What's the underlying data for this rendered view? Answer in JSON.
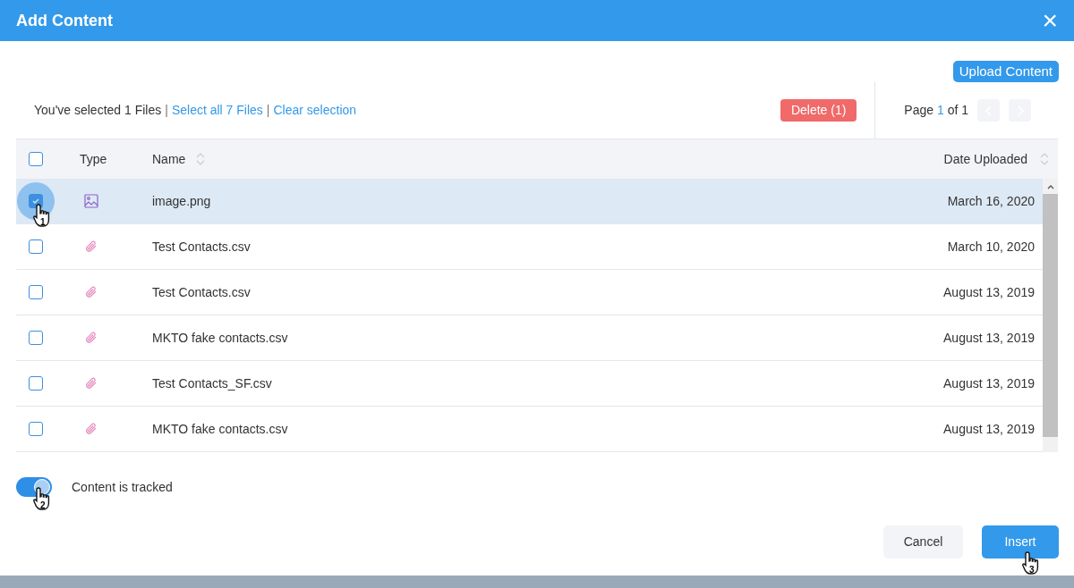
{
  "dialog": {
    "title": "Add Content",
    "close": "×"
  },
  "upload_button": "Upload Content",
  "selection": {
    "summary": "You've selected 1 Files",
    "separator_1": "|",
    "select_all": "Select all 7 Files",
    "separator_2": "|",
    "clear": "Clear selection"
  },
  "delete_button": "Delete (1)",
  "pager": {
    "label": "Page",
    "current": "1",
    "of": "of 1",
    "prev_disabled": true,
    "next_disabled": true
  },
  "table": {
    "columns": [
      "Type",
      "Name",
      "Date Uploaded"
    ],
    "select_all_checked": false,
    "rows": [
      {
        "kind": "image",
        "name": "image.png",
        "date": "March 16, 2020",
        "checked": true,
        "selected": true,
        "callout": "1"
      },
      {
        "kind": "attachment",
        "name": "Test Contacts.csv",
        "date": "March 10, 2020",
        "checked": false,
        "selected": false
      },
      {
        "kind": "attachment",
        "name": "Test Contacts.csv",
        "date": "August 13, 2019",
        "checked": false,
        "selected": false
      },
      {
        "kind": "attachment",
        "name": "MKTO fake contacts.csv",
        "date": "August 13, 2019",
        "checked": false,
        "selected": false
      },
      {
        "kind": "attachment",
        "name": "Test Contacts_SF.csv",
        "date": "August 13, 2019",
        "checked": false,
        "selected": false
      },
      {
        "kind": "attachment",
        "name": "MKTO fake contacts.csv",
        "date": "August 13, 2019",
        "checked": false,
        "selected": false
      }
    ]
  },
  "tracking": {
    "label": "Content is tracked",
    "on": true,
    "callout": "2"
  },
  "buttons": {
    "cancel": "Cancel",
    "insert": "Insert",
    "insert_callout": "3"
  }
}
